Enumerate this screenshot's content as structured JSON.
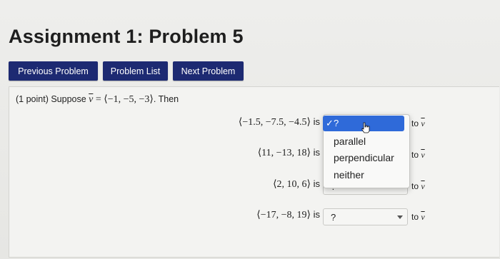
{
  "page": {
    "title": "Assignment 1: Problem 5"
  },
  "nav": {
    "prev_label": "Previous Problem",
    "list_label": "Problem List",
    "next_label": "Next Problem"
  },
  "colors": {
    "nav_button_bg": "#1d2a72",
    "menu_highlight": "#2f6ad9"
  },
  "problem": {
    "points": "(1 point) Suppose ",
    "vector_symbol": "v",
    "equals_vector": " = ⟨−1, −5, −3⟩",
    "then": ". Then",
    "rows": [
      {
        "vector": "⟨−1.5, −7.5, −4.5⟩",
        "is": " is",
        "to": "to "
      },
      {
        "vector": "⟨11, −13, 18⟩",
        "is": " is",
        "to": "to "
      },
      {
        "vector": "⟨2, 10, 6⟩",
        "is": " is",
        "selected": "?",
        "to": "to "
      },
      {
        "vector": "⟨−17, −8, 19⟩",
        "is": " is",
        "selected": "?",
        "to": "to "
      }
    ],
    "dropdown": {
      "highlighted_check": "✓",
      "highlighted": "?",
      "options": [
        "parallel",
        "perpendicular",
        "neither"
      ]
    }
  },
  "icons": {
    "check": "check-icon",
    "cursor": "hand-pointer-icon",
    "chevron": "chevron-down-icon"
  }
}
